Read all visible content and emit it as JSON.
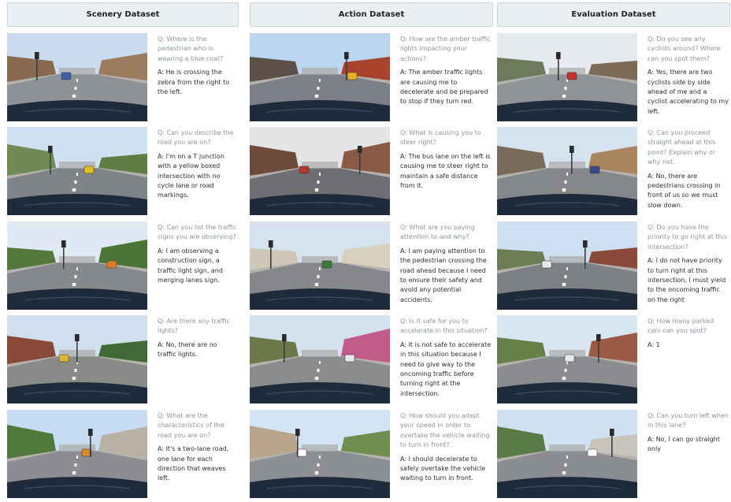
{
  "columns": [
    {
      "title": "Scenery Dataset",
      "rows": [
        {
          "q": "Q: Where is the pedestrian who is wearing a blue coat?",
          "a": "A: He is crossing the zebra from the right to the left."
        },
        {
          "q": "Q: Can you describe the road you are on?",
          "a": "A: I'm on a T junction with a yellow boxed intersection with no cycle lane or road markings."
        },
        {
          "q": "Q: Can you list the traffic signs you are observing?",
          "a": "A: I am observing a construction sign, a traffic light sign, and merging lanes sign."
        },
        {
          "q": "Q: Are there any traffic lights?",
          "a": "A: No, there are no traffic lights."
        },
        {
          "q": "Q: What are the characteristics of the road you are on?",
          "a": "A: It's a two-lane road, one lane for each direction that weaves left."
        }
      ]
    },
    {
      "title": "Action Dataset",
      "rows": [
        {
          "q": "Q: How are the amber traffic lights impacting your actions?",
          "a": "A: The amber traffic lights are causing me to decelerate and be prepared to stop if they turn red."
        },
        {
          "q": "Q: What is causing you to steer right?",
          "a": "A: The bus lane on the left is causing me to steer right to maintain a safe distance from it."
        },
        {
          "q": "Q: What are you paying attention to and why?",
          "a": "A: I am paying attention to the pedestrian crossing the road ahead because I need to ensure their safety and avoid any potential accidents."
        },
        {
          "q": "Q: Is it safe for you to accelerate in this situation?",
          "a": "A: It is not safe to accelerate in this situation because I need to give way to the oncoming traffic before turning right at the intersection."
        },
        {
          "q": "Q: How should you adapt your speed in order to overtake the vehicle waiting to turn in front?",
          "a": "A: I should decelerate to safely overtake the vehicle waiting to turn in front."
        }
      ]
    },
    {
      "title": "Evaluation Dataset",
      "rows": [
        {
          "q": "Q: Do you see any cyclists around? Where can you spot them?",
          "a": "A: Yes, there are two cyclists side by side ahead of me and a cyclist accelerating to my left."
        },
        {
          "q": "Q: Can you proceed straight ahead at this point? Explain why or why not.",
          "a": "A: No, there are pedestrians crossing in front of us so we must slow down."
        },
        {
          "q": "Q: Do you have the priority to go right at this intersection?",
          "a": "A: I do not have priority to turn right at this intersection, I must yield to the oncoming traffic on the right"
        },
        {
          "q": "Q: How many parked cars can you spot?",
          "a": "A: 1"
        },
        {
          "q": "Q: Can you turn left when in this lane?",
          "a": "A: No, I can go straight only"
        }
      ]
    }
  ],
  "scenes": [
    [
      {
        "sky": "#c9dbef",
        "ground": "#8e9196",
        "left": "#8a6a4e",
        "right": "#9c7b5e",
        "accent": "#3a5fa8"
      },
      {
        "sky": "#cfe0f0",
        "ground": "#7f8489",
        "left": "#6f8a55",
        "right": "#5f7d45",
        "accent": "#e2c21e"
      },
      {
        "sky": "#dfe9f3",
        "ground": "#86898c",
        "left": "#55783f",
        "right": "#4d7438",
        "accent": "#e07b2c"
      },
      {
        "sky": "#cfdfee",
        "ground": "#8a8b88",
        "left": "#8a4a3a",
        "right": "#3f6a35",
        "accent": "#d9b82e"
      },
      {
        "sky": "#c7dcf2",
        "ground": "#8b8d90",
        "left": "#4f7a3c",
        "right": "#b9b2a4",
        "accent": "#d98a2a"
      }
    ],
    [
      {
        "sky": "#bcd6f2",
        "ground": "#7c8086",
        "left": "#5c5048",
        "right": "#a8442e",
        "accent": "#e8b020"
      },
      {
        "sky": "#e2e4e6",
        "ground": "#6d6f73",
        "left": "#6e4a3a",
        "right": "#8a5a44",
        "accent": "#b3382e"
      },
      {
        "sky": "#d6e2ee",
        "ground": "#85878a",
        "left": "#cfc8b8",
        "right": "#d8d0bf",
        "accent": "#3b7a34"
      },
      {
        "sky": "#d4e2ef",
        "ground": "#8a8c8e",
        "left": "#6b7a48",
        "right": "#c25a8a",
        "accent": "#e8e8e8"
      },
      {
        "sky": "#d2e4f3",
        "ground": "#8d9093",
        "left": "#b9a58c",
        "right": "#6f8d4c",
        "accent": "#ffffff"
      }
    ],
    [
      {
        "sky": "#e6eaee",
        "ground": "#909395",
        "left": "#6d7a5c",
        "right": "#7d6a58",
        "accent": "#c83030"
      },
      {
        "sky": "#d5e3f1",
        "ground": "#85888b",
        "left": "#7a6a5a",
        "right": "#a9845e",
        "accent": "#3a4a8a"
      },
      {
        "sky": "#cddff0",
        "ground": "#7d8084",
        "left": "#6b7d52",
        "right": "#8a4a3a",
        "accent": "#e8e8e8"
      },
      {
        "sky": "#d9e5f0",
        "ground": "#8a8c8f",
        "left": "#66804a",
        "right": "#9a5a46",
        "accent": "#e8e8e8"
      },
      {
        "sky": "#cfe0f1",
        "ground": "#8a8d91",
        "left": "#5a7a48",
        "right": "#c8c4bc",
        "accent": "#ffffff"
      }
    ]
  ]
}
